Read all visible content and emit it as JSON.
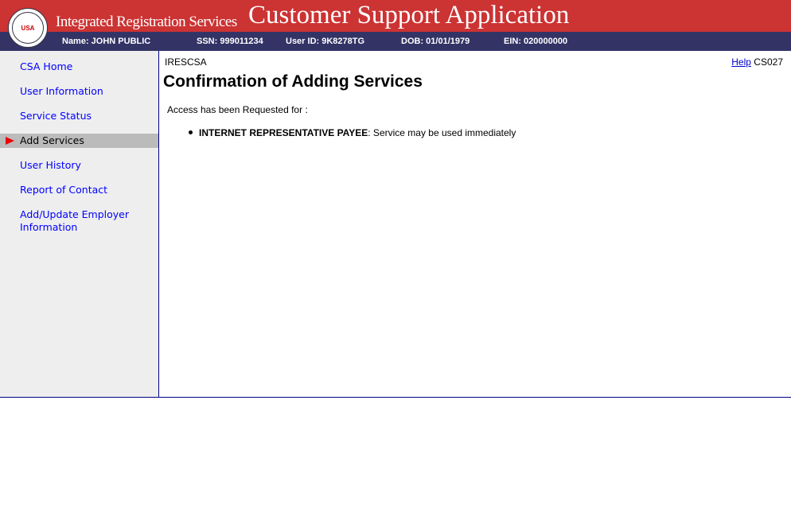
{
  "header": {
    "logo_text": "SOCIAL SECURITY ADMINISTRATION USA",
    "subtitle": "Integrated Registration Services",
    "title": "Customer Support Application"
  },
  "user_bar": {
    "name": "Name: JOHN PUBLIC",
    "ssn": "SSN: 999011234",
    "user_id": "User ID: 9K8278TG",
    "dob": "DOB: 01/01/1979",
    "ein": "EIN: 020000000"
  },
  "sidebar": {
    "items": [
      {
        "label": "CSA Home"
      },
      {
        "label": "User Information"
      },
      {
        "label": "Service Status"
      },
      {
        "label": "Add Services",
        "active": true
      },
      {
        "label": "User History"
      },
      {
        "label": "Report of Contact"
      },
      {
        "label": "Add/Update Employer Information"
      }
    ],
    "active_marker_color": "#ee0000"
  },
  "main": {
    "app_code": "IRESCSA",
    "help_label": "Help",
    "screen_code": "CS027",
    "title": "Confirmation of Adding Services",
    "request_text": "Access has been Requested for :",
    "services": [
      {
        "name": "INTERNET REPRESENTATIVE PAYEE",
        "status": ": Service may be used immediately"
      }
    ]
  }
}
